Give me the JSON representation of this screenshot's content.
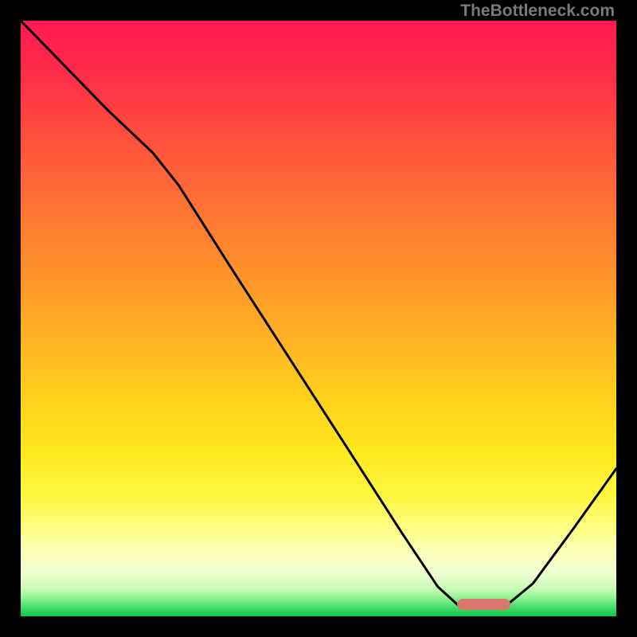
{
  "watermark": "TheBottleneck.com",
  "marker": {
    "x_frac": 0.732,
    "y_frac": 0.9705,
    "w_frac": 0.09,
    "h_frac": 0.019
  },
  "gradient": {
    "stops": [
      {
        "t": 0.0,
        "color": "#ff1a53"
      },
      {
        "t": 0.08,
        "color": "#ff2a4a"
      },
      {
        "t": 0.16,
        "color": "#ff4440"
      },
      {
        "t": 0.24,
        "color": "#ff5d3a"
      },
      {
        "t": 0.32,
        "color": "#ff7534"
      },
      {
        "t": 0.4,
        "color": "#ff8c2e"
      },
      {
        "t": 0.48,
        "color": "#ffa328"
      },
      {
        "t": 0.56,
        "color": "#ffba22"
      },
      {
        "t": 0.64,
        "color": "#ffd21d"
      },
      {
        "t": 0.72,
        "color": "#ffe71d"
      },
      {
        "t": 0.8,
        "color": "#fff741"
      },
      {
        "t": 0.86,
        "color": "#feff8d"
      },
      {
        "t": 0.9,
        "color": "#fbffc0"
      },
      {
        "t": 0.93,
        "color": "#ecffd0"
      },
      {
        "t": 0.955,
        "color": "#c7fcb4"
      },
      {
        "t": 0.972,
        "color": "#8bf08f"
      },
      {
        "t": 0.986,
        "color": "#44dd6a"
      },
      {
        "t": 1.0,
        "color": "#14c94e"
      }
    ]
  },
  "chart_data": {
    "type": "line",
    "title": "",
    "xlabel": "",
    "ylabel": "",
    "ylim": [
      0,
      1
    ],
    "xlim": [
      0,
      1
    ],
    "series": [
      {
        "name": "bottleneck-curve",
        "points": [
          {
            "x": 0.0,
            "y": 1.0
          },
          {
            "x": 0.146,
            "y": 0.85
          },
          {
            "x": 0.222,
            "y": 0.778
          },
          {
            "x": 0.265,
            "y": 0.724
          },
          {
            "x": 0.35,
            "y": 0.59
          },
          {
            "x": 0.45,
            "y": 0.435
          },
          {
            "x": 0.55,
            "y": 0.28
          },
          {
            "x": 0.64,
            "y": 0.14
          },
          {
            "x": 0.7,
            "y": 0.05
          },
          {
            "x": 0.735,
            "y": 0.018
          },
          {
            "x": 0.815,
            "y": 0.018
          },
          {
            "x": 0.86,
            "y": 0.055
          },
          {
            "x": 0.93,
            "y": 0.15
          },
          {
            "x": 1.0,
            "y": 0.248
          }
        ]
      }
    ],
    "marker_range_x": [
      0.732,
      0.822
    ]
  }
}
